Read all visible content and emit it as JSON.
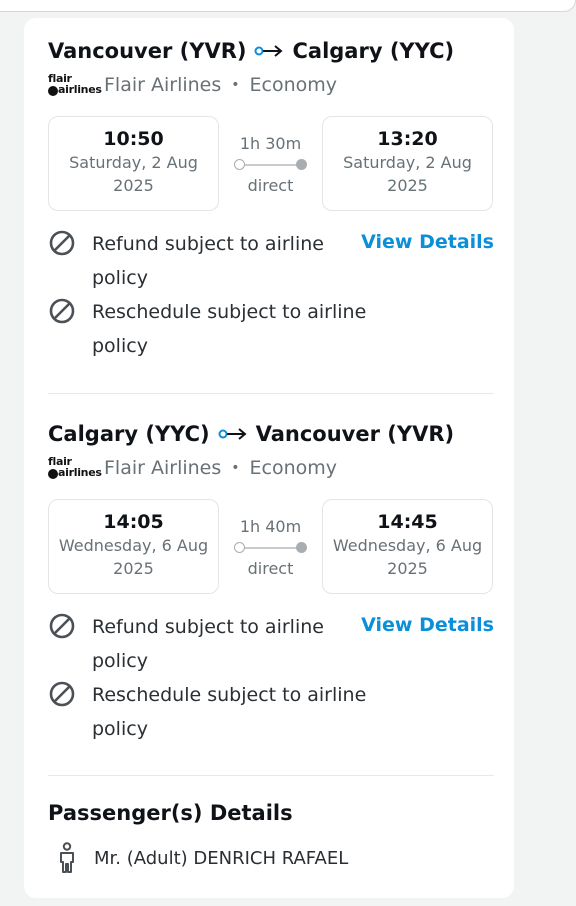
{
  "flights": [
    {
      "origin": "Vancouver (YVR)",
      "destination": "Calgary (YYC)",
      "airline": "Flair Airlines",
      "cabin": "Economy",
      "departure": {
        "time": "10:50",
        "day": "Saturday, 2 Aug",
        "year": "2025"
      },
      "arrival": {
        "time": "13:20",
        "day": "Saturday, 2 Aug",
        "year": "2025"
      },
      "duration": "1h 30m",
      "stops": "direct",
      "refund": {
        "line1": "Refund subject to airline",
        "line2": "policy"
      },
      "reschedule": {
        "line1": "Reschedule subject to airline",
        "line2": "policy"
      },
      "view_details_label": "View Details"
    },
    {
      "origin": "Calgary (YYC)",
      "destination": "Vancouver (YVR)",
      "airline": "Flair Airlines",
      "cabin": "Economy",
      "departure": {
        "time": "14:05",
        "day": "Wednesday, 6 Aug",
        "year": "2025"
      },
      "arrival": {
        "time": "14:45",
        "day": "Wednesday, 6 Aug",
        "year": "2025"
      },
      "duration": "1h 40m",
      "stops": "direct",
      "refund": {
        "line1": "Refund subject to airline",
        "line2": "policy"
      },
      "reschedule": {
        "line1": "Reschedule subject to airline",
        "line2": "policy"
      },
      "view_details_label": "View Details"
    }
  ],
  "airline_logo": {
    "line1": "flair",
    "line2": "airlines"
  },
  "separator": "•",
  "passengers": {
    "title": "Passenger(s) Details",
    "items": [
      {
        "name": "Mr. (Adult) DENRICH RAFAEL",
        "icon": "person-icon"
      }
    ]
  },
  "colors": {
    "link": "#0a8fd8",
    "muted": "#687176",
    "text": "#0f1216"
  }
}
